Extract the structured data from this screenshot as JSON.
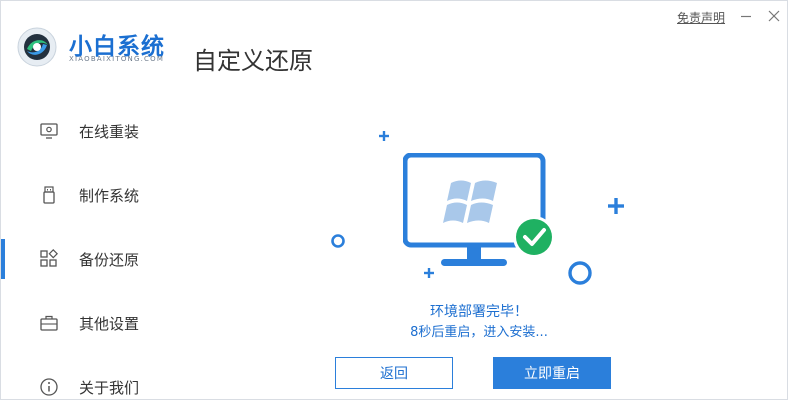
{
  "app": {
    "brand_name": "小白系统",
    "brand_sub": "XIAOBAIXITONG.COM",
    "page_title": "自定义还原",
    "disclaimer": "免责声明"
  },
  "colors": {
    "accent": "#2b7fdb",
    "success": "#1fb162"
  },
  "sidebar": {
    "items": [
      {
        "label": "在线重装",
        "icon": "monitor-icon"
      },
      {
        "label": "制作系统",
        "icon": "usb-drive-icon"
      },
      {
        "label": "备份还原",
        "icon": "grid-blocks-icon",
        "active": true
      },
      {
        "label": "其他设置",
        "icon": "toolbox-icon"
      },
      {
        "label": "关于我们",
        "icon": "info-icon"
      }
    ]
  },
  "status": {
    "main": "环境部署完毕！",
    "sub": "8秒后重启，进入安装..."
  },
  "buttons": {
    "back": "返回",
    "restart": "立即重启"
  }
}
